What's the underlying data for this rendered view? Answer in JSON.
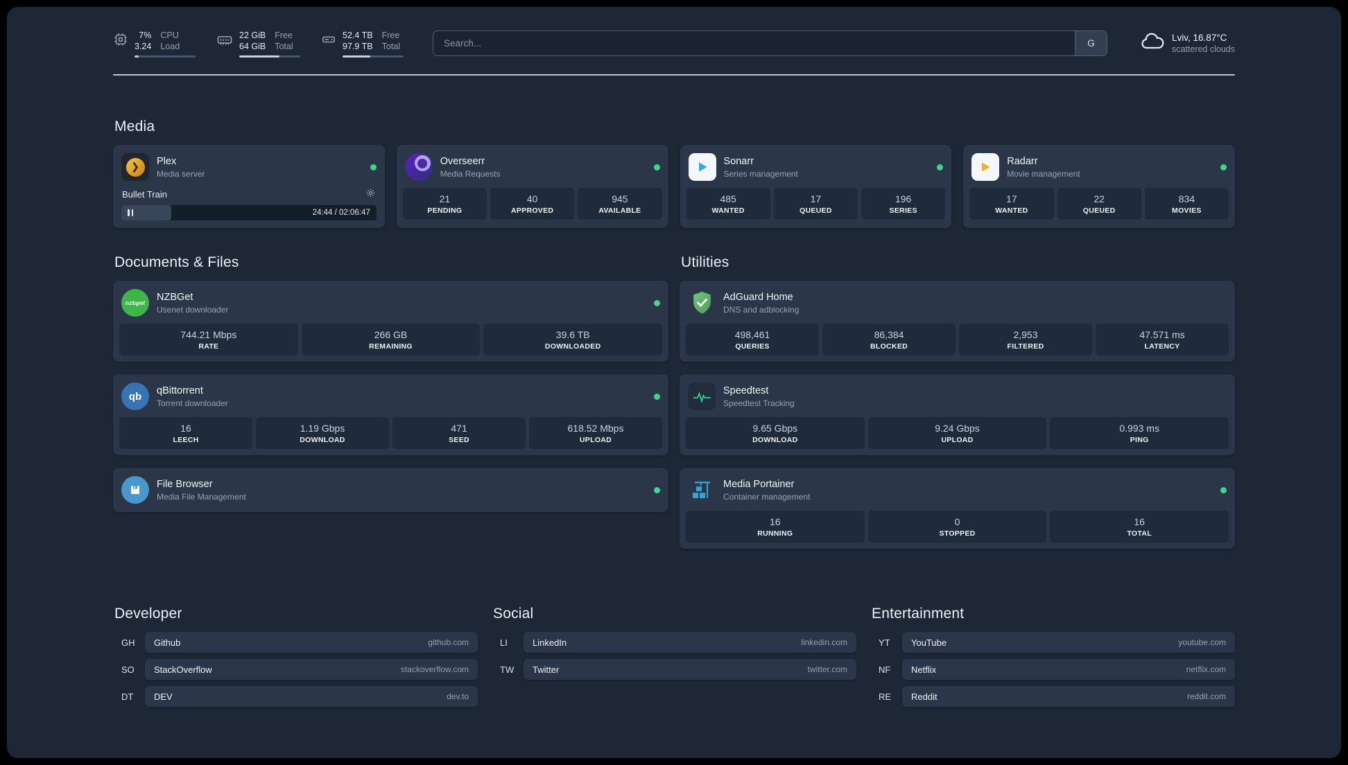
{
  "topbar": {
    "resources": [
      {
        "name": "cpu",
        "values": [
          "7%",
          "3.24"
        ],
        "labels": [
          "CPU",
          "Load"
        ],
        "bar": 7
      },
      {
        "name": "memory",
        "values": [
          "22 GiB",
          "64 GiB"
        ],
        "labels": [
          "Free",
          "Total"
        ],
        "bar": 66
      },
      {
        "name": "disk",
        "values": [
          "52.4 TB",
          "97.9 TB"
        ],
        "labels": [
          "Free",
          "Total"
        ],
        "bar": 46
      }
    ],
    "search": {
      "placeholder": "Search...",
      "button": "G"
    },
    "weather": {
      "location": "Lviv, 16.87°C",
      "condition": "scattered clouds"
    }
  },
  "media": {
    "title": "Media",
    "plex": {
      "name": "Plex",
      "desc": "Media server",
      "player": {
        "track": "Bullet Train",
        "time": "24:44 / 02:06:47",
        "progress": 19.5
      }
    },
    "overseerr": {
      "name": "Overseerr",
      "desc": "Media Requests",
      "stats": [
        {
          "v": "21",
          "l": "PENDING"
        },
        {
          "v": "40",
          "l": "APPROVED"
        },
        {
          "v": "945",
          "l": "AVAILABLE"
        }
      ]
    },
    "sonarr": {
      "name": "Sonarr",
      "desc": "Series management",
      "stats": [
        {
          "v": "485",
          "l": "WANTED"
        },
        {
          "v": "17",
          "l": "QUEUED"
        },
        {
          "v": "196",
          "l": "SERIES"
        }
      ]
    },
    "radarr": {
      "name": "Radarr",
      "desc": "Movie management",
      "stats": [
        {
          "v": "17",
          "l": "WANTED"
        },
        {
          "v": "22",
          "l": "QUEUED"
        },
        {
          "v": "834",
          "l": "MOVIES"
        }
      ]
    }
  },
  "documents": {
    "title": "Documents & Files",
    "nzbget": {
      "name": "NZBGet",
      "desc": "Usenet downloader",
      "icon_text": "nzbget",
      "stats": [
        {
          "v": "744.21 Mbps",
          "l": "RATE"
        },
        {
          "v": "266 GB",
          "l": "REMAINING"
        },
        {
          "v": "39.6 TB",
          "l": "DOWNLOADED"
        }
      ]
    },
    "qbittorrent": {
      "name": "qBittorrent",
      "desc": "Torrent downloader",
      "icon_text": "qb",
      "stats": [
        {
          "v": "16",
          "l": "LEECH"
        },
        {
          "v": "1.19 Gbps",
          "l": "DOWNLOAD"
        },
        {
          "v": "471",
          "l": "SEED"
        },
        {
          "v": "618.52 Mbps",
          "l": "UPLOAD"
        }
      ]
    },
    "filebrowser": {
      "name": "File Browser",
      "desc": "Media File Management"
    }
  },
  "utilities": {
    "title": "Utilities",
    "adguard": {
      "name": "AdGuard Home",
      "desc": "DNS and adblocking",
      "stats": [
        {
          "v": "498,461",
          "l": "QUERIES"
        },
        {
          "v": "86,384",
          "l": "BLOCKED"
        },
        {
          "v": "2,953",
          "l": "FILTERED"
        },
        {
          "v": "47.571 ms",
          "l": "LATENCY"
        }
      ]
    },
    "speedtest": {
      "name": "Speedtest",
      "desc": "Speedtest Tracking",
      "stats": [
        {
          "v": "9.65 Gbps",
          "l": "DOWNLOAD"
        },
        {
          "v": "9.24 Gbps",
          "l": "UPLOAD"
        },
        {
          "v": "0.993 ms",
          "l": "PING"
        }
      ]
    },
    "portainer": {
      "name": "Media Portainer",
      "desc": "Container management",
      "stats": [
        {
          "v": "16",
          "l": "RUNNING"
        },
        {
          "v": "0",
          "l": "STOPPED"
        },
        {
          "v": "16",
          "l": "TOTAL"
        }
      ]
    }
  },
  "bookmarks": {
    "developer": {
      "title": "Developer",
      "items": [
        {
          "abbr": "GH",
          "name": "Github",
          "url": "github.com"
        },
        {
          "abbr": "SO",
          "name": "StackOverflow",
          "url": "stackoverflow.com"
        },
        {
          "abbr": "DT",
          "name": "DEV",
          "url": "dev.to"
        }
      ]
    },
    "social": {
      "title": "Social",
      "items": [
        {
          "abbr": "LI",
          "name": "LinkedIn",
          "url": "linkedin.com"
        },
        {
          "abbr": "TW",
          "name": "Twitter",
          "url": "twitter.com"
        }
      ]
    },
    "entertainment": {
      "title": "Entertainment",
      "items": [
        {
          "abbr": "YT",
          "name": "YouTube",
          "url": "youtube.com"
        },
        {
          "abbr": "NF",
          "name": "Netflix",
          "url": "netflix.com"
        },
        {
          "abbr": "RE",
          "name": "Reddit",
          "url": "reddit.com"
        }
      ]
    }
  },
  "icons": {
    "cpu": "cpu-chip-icon",
    "memory": "ram-stick-icon",
    "disk": "hard-drive-icon",
    "weather": "cloud-icon",
    "search_provider": "google-button",
    "gear": "gear-icon",
    "pause": "pause-icon",
    "status": "status-dot",
    "plex": "plex-gold-circle",
    "overseerr": "purple-swirl",
    "sonarr": "blue-play",
    "radarr": "yellow-play",
    "nzbget": "green-badge",
    "qbittorrent": "blue-badge",
    "filebrowser": "floppy-disk",
    "adguard": "shield-check",
    "speedtest": "pulse-line",
    "portainer": "container-crane"
  },
  "colors": {
    "page_bg": "#1d2736",
    "card_bg": "#2b3748",
    "stat_bg": "#1f2a3a",
    "status_online": "#3dd68c",
    "plex_gold": "#e5a00d",
    "sonarr_blue": "#35a8e0",
    "radarr_yellow": "#f5b12d",
    "nzbget_green": "#3db549",
    "qbittorrent_blue": "#3873b3",
    "adguard_green": "#5fbc66",
    "speedtest_green": "#2fd19a",
    "portainer_blue": "#36a3d9",
    "overseerr_purple": "#5b21b6"
  }
}
